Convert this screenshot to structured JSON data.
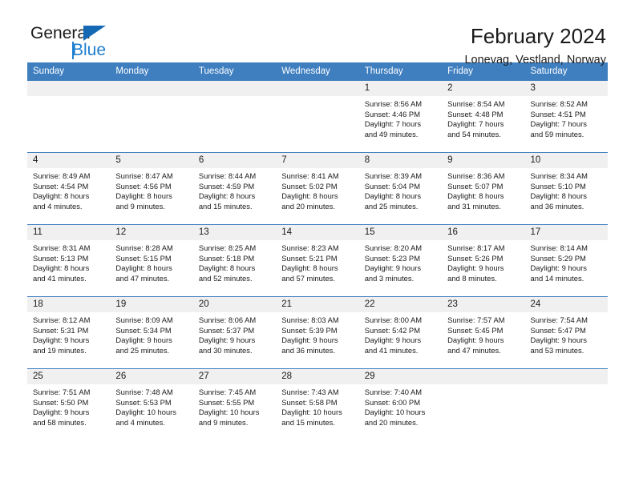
{
  "brand": {
    "name_dark": "General",
    "name_blue": "Blue",
    "accent_blue": "#1f7fd0",
    "triangle_blue": "#1569b4"
  },
  "header": {
    "title": "February 2024",
    "subtitle": "Lonevag, Vestland, Norway"
  },
  "calendar": {
    "header_bg": "#3f7fbf",
    "daynum_bg": "#f0f0f0",
    "weekday_headers": [
      "Sunday",
      "Monday",
      "Tuesday",
      "Wednesday",
      "Thursday",
      "Friday",
      "Saturday"
    ],
    "weeks": [
      [
        {
          "day": "",
          "lines": []
        },
        {
          "day": "",
          "lines": []
        },
        {
          "day": "",
          "lines": []
        },
        {
          "day": "",
          "lines": []
        },
        {
          "day": "1",
          "lines": [
            "Sunrise: 8:56 AM",
            "Sunset: 4:46 PM",
            "Daylight: 7 hours",
            "and 49 minutes."
          ]
        },
        {
          "day": "2",
          "lines": [
            "Sunrise: 8:54 AM",
            "Sunset: 4:48 PM",
            "Daylight: 7 hours",
            "and 54 minutes."
          ]
        },
        {
          "day": "3",
          "lines": [
            "Sunrise: 8:52 AM",
            "Sunset: 4:51 PM",
            "Daylight: 7 hours",
            "and 59 minutes."
          ]
        }
      ],
      [
        {
          "day": "4",
          "lines": [
            "Sunrise: 8:49 AM",
            "Sunset: 4:54 PM",
            "Daylight: 8 hours",
            "and 4 minutes."
          ]
        },
        {
          "day": "5",
          "lines": [
            "Sunrise: 8:47 AM",
            "Sunset: 4:56 PM",
            "Daylight: 8 hours",
            "and 9 minutes."
          ]
        },
        {
          "day": "6",
          "lines": [
            "Sunrise: 8:44 AM",
            "Sunset: 4:59 PM",
            "Daylight: 8 hours",
            "and 15 minutes."
          ]
        },
        {
          "day": "7",
          "lines": [
            "Sunrise: 8:41 AM",
            "Sunset: 5:02 PM",
            "Daylight: 8 hours",
            "and 20 minutes."
          ]
        },
        {
          "day": "8",
          "lines": [
            "Sunrise: 8:39 AM",
            "Sunset: 5:04 PM",
            "Daylight: 8 hours",
            "and 25 minutes."
          ]
        },
        {
          "day": "9",
          "lines": [
            "Sunrise: 8:36 AM",
            "Sunset: 5:07 PM",
            "Daylight: 8 hours",
            "and 31 minutes."
          ]
        },
        {
          "day": "10",
          "lines": [
            "Sunrise: 8:34 AM",
            "Sunset: 5:10 PM",
            "Daylight: 8 hours",
            "and 36 minutes."
          ]
        }
      ],
      [
        {
          "day": "11",
          "lines": [
            "Sunrise: 8:31 AM",
            "Sunset: 5:13 PM",
            "Daylight: 8 hours",
            "and 41 minutes."
          ]
        },
        {
          "day": "12",
          "lines": [
            "Sunrise: 8:28 AM",
            "Sunset: 5:15 PM",
            "Daylight: 8 hours",
            "and 47 minutes."
          ]
        },
        {
          "day": "13",
          "lines": [
            "Sunrise: 8:25 AM",
            "Sunset: 5:18 PM",
            "Daylight: 8 hours",
            "and 52 minutes."
          ]
        },
        {
          "day": "14",
          "lines": [
            "Sunrise: 8:23 AM",
            "Sunset: 5:21 PM",
            "Daylight: 8 hours",
            "and 57 minutes."
          ]
        },
        {
          "day": "15",
          "lines": [
            "Sunrise: 8:20 AM",
            "Sunset: 5:23 PM",
            "Daylight: 9 hours",
            "and 3 minutes."
          ]
        },
        {
          "day": "16",
          "lines": [
            "Sunrise: 8:17 AM",
            "Sunset: 5:26 PM",
            "Daylight: 9 hours",
            "and 8 minutes."
          ]
        },
        {
          "day": "17",
          "lines": [
            "Sunrise: 8:14 AM",
            "Sunset: 5:29 PM",
            "Daylight: 9 hours",
            "and 14 minutes."
          ]
        }
      ],
      [
        {
          "day": "18",
          "lines": [
            "Sunrise: 8:12 AM",
            "Sunset: 5:31 PM",
            "Daylight: 9 hours",
            "and 19 minutes."
          ]
        },
        {
          "day": "19",
          "lines": [
            "Sunrise: 8:09 AM",
            "Sunset: 5:34 PM",
            "Daylight: 9 hours",
            "and 25 minutes."
          ]
        },
        {
          "day": "20",
          "lines": [
            "Sunrise: 8:06 AM",
            "Sunset: 5:37 PM",
            "Daylight: 9 hours",
            "and 30 minutes."
          ]
        },
        {
          "day": "21",
          "lines": [
            "Sunrise: 8:03 AM",
            "Sunset: 5:39 PM",
            "Daylight: 9 hours",
            "and 36 minutes."
          ]
        },
        {
          "day": "22",
          "lines": [
            "Sunrise: 8:00 AM",
            "Sunset: 5:42 PM",
            "Daylight: 9 hours",
            "and 41 minutes."
          ]
        },
        {
          "day": "23",
          "lines": [
            "Sunrise: 7:57 AM",
            "Sunset: 5:45 PM",
            "Daylight: 9 hours",
            "and 47 minutes."
          ]
        },
        {
          "day": "24",
          "lines": [
            "Sunrise: 7:54 AM",
            "Sunset: 5:47 PM",
            "Daylight: 9 hours",
            "and 53 minutes."
          ]
        }
      ],
      [
        {
          "day": "25",
          "lines": [
            "Sunrise: 7:51 AM",
            "Sunset: 5:50 PM",
            "Daylight: 9 hours",
            "and 58 minutes."
          ]
        },
        {
          "day": "26",
          "lines": [
            "Sunrise: 7:48 AM",
            "Sunset: 5:53 PM",
            "Daylight: 10 hours",
            "and 4 minutes."
          ]
        },
        {
          "day": "27",
          "lines": [
            "Sunrise: 7:45 AM",
            "Sunset: 5:55 PM",
            "Daylight: 10 hours",
            "and 9 minutes."
          ]
        },
        {
          "day": "28",
          "lines": [
            "Sunrise: 7:43 AM",
            "Sunset: 5:58 PM",
            "Daylight: 10 hours",
            "and 15 minutes."
          ]
        },
        {
          "day": "29",
          "lines": [
            "Sunrise: 7:40 AM",
            "Sunset: 6:00 PM",
            "Daylight: 10 hours",
            "and 20 minutes."
          ]
        },
        {
          "day": "",
          "lines": []
        },
        {
          "day": "",
          "lines": []
        }
      ]
    ]
  }
}
